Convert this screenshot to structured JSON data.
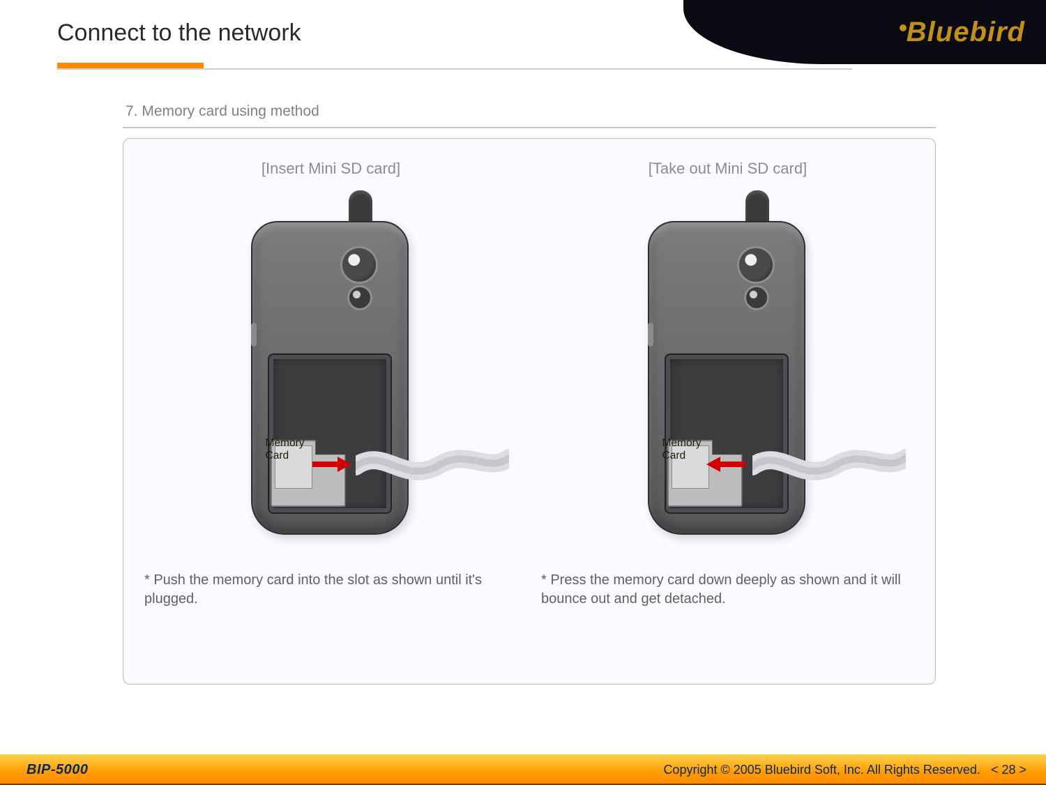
{
  "brand": "Bluebird",
  "page_title": "Connect to the network",
  "section_title": "7. Memory card using method",
  "left": {
    "heading": "[Insert Mini SD card]",
    "mem_label_line1": "Memory",
    "mem_label_line2": "Card",
    "caption": "* Push the memory card into the slot as shown until it's plugged."
  },
  "right": {
    "heading": "[Take out Mini SD card]",
    "mem_label_line1": "Memory",
    "mem_label_line2": "Card",
    "caption": "* Press the memory card down deeply as shown and it will bounce out and get detached."
  },
  "footer": {
    "model": "BIP-5000",
    "copyright": "Copyright © 2005 Bluebird Soft, Inc. All Rights Reserved.",
    "page_number": "< 28 >"
  },
  "colors": {
    "accent_orange": "#ff8a00",
    "brand_gold": "#c0901a",
    "footer_text": "#0b2a5a"
  }
}
